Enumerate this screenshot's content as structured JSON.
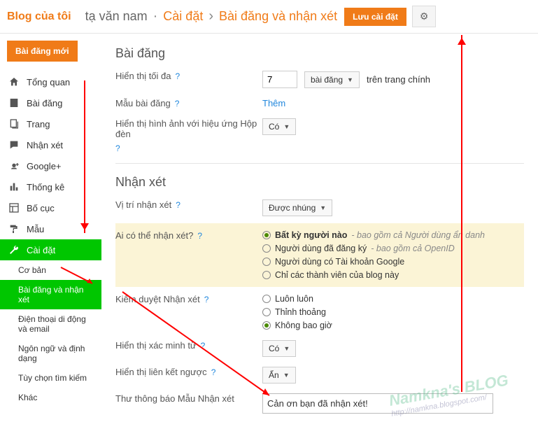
{
  "header": {
    "blog_title": "Blog của tôi",
    "owner": "tạ văn nam",
    "breadcrumb1": "Cài đặt",
    "breadcrumb2": "Bài đăng và nhận xét",
    "save_label": "Lưu cài đặt"
  },
  "sidebar": {
    "new_post": "Bài đăng mới",
    "items": [
      {
        "label": "Tổng quan"
      },
      {
        "label": "Bài đăng"
      },
      {
        "label": "Trang"
      },
      {
        "label": "Nhận xét"
      },
      {
        "label": "Google+"
      },
      {
        "label": "Thống kê"
      },
      {
        "label": "Bố cục"
      },
      {
        "label": "Mẫu"
      },
      {
        "label": "Cài đặt"
      }
    ],
    "sub": [
      {
        "label": "Cơ bản"
      },
      {
        "label": "Bài đăng và nhận xét"
      },
      {
        "label": "Điện thoại di động và email"
      },
      {
        "label": "Ngôn ngữ và định dạng"
      },
      {
        "label": "Tùy chọn tìm kiếm"
      },
      {
        "label": "Khác"
      }
    ]
  },
  "posts": {
    "title": "Bài đăng",
    "show_max": "Hiển thị tối đa",
    "show_max_val": "7",
    "show_max_unit": "bài đăng",
    "show_max_suffix": "trên trang chính",
    "template": "Mẫu bài đăng",
    "template_add": "Thêm",
    "lightbox": "Hiển thị hình ảnh với hiệu ứng Hộp đèn",
    "lightbox_val": "Có"
  },
  "comments": {
    "title": "Nhận xét",
    "location": "Vị trí nhận xét",
    "location_val": "Được nhúng",
    "who": "Ai có thể nhận xét?",
    "who_opts": [
      {
        "label": "Bất kỳ người nào",
        "sub": "- bao gồm cả Người dùng ẩn danh",
        "sel": true
      },
      {
        "label": "Người dùng đã đăng ký",
        "sub": "- bao gồm cả OpenID",
        "sel": false
      },
      {
        "label": "Người dùng có Tài khoản Google",
        "sub": "",
        "sel": false
      },
      {
        "label": "Chỉ các thành viên của blog này",
        "sub": "",
        "sel": false
      }
    ],
    "moderation": "Kiểm duyệt Nhận xét",
    "mod_opts": [
      {
        "label": "Luôn luôn",
        "sel": false
      },
      {
        "label": "Thỉnh thoảng",
        "sel": false
      },
      {
        "label": "Không bao giờ",
        "sel": true
      }
    ],
    "verify": "Hiển thị xác minh từ",
    "verify_val": "Có",
    "backlinks": "Hiển thị liên kết ngược",
    "backlinks_val": "Ẩn",
    "msg_label": "Thư thông báo Mẫu Nhận xét",
    "msg_val": "Cản ơn bạn đã nhận xét!"
  },
  "watermark": {
    "line1": "Namkna's BLOG",
    "line2": "http://namkna.blogspot.com/"
  }
}
